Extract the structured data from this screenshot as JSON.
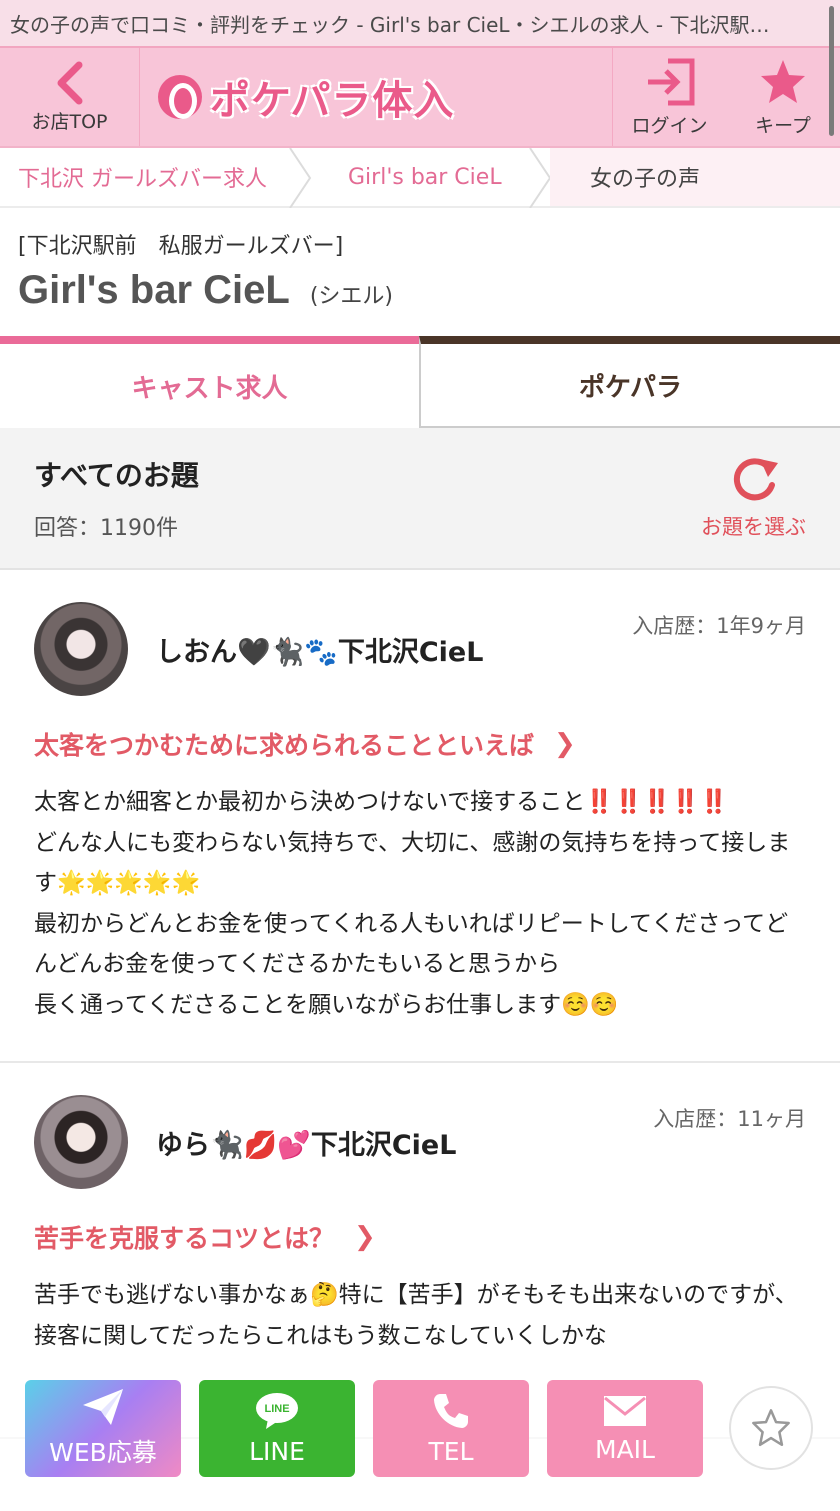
{
  "browser": {
    "title": "女の子の声で口コミ・評判をチェック - Girl's bar CieL・シエルの求人 - 下北沢駅…"
  },
  "header": {
    "back_label": "お店TOP",
    "logo_text": "ポケパラ体入",
    "login_label": "ログイン",
    "keep_label": "キープ"
  },
  "breadcrumb": [
    {
      "label": "下北沢 ガールズバー求人"
    },
    {
      "label": "Girl's bar CieL"
    },
    {
      "label": "女の子の声"
    }
  ],
  "shop": {
    "category": "[下北沢駅前　私服ガールズバー]",
    "name": "Girl's bar CieL",
    "kana": "(シエル)"
  },
  "tabs": [
    {
      "label": "キャスト求人"
    },
    {
      "label": "ポケパラ"
    }
  ],
  "theme": {
    "title": "すべてのお題",
    "count": "回答：1190件",
    "choose_label": "お題を選ぶ"
  },
  "posts": [
    {
      "name": "しおん🖤🐈‍⬛🐾下北沢CieL",
      "tenure": "入店歴：1年9ヶ月",
      "question": "太客をつかむために求められることといえば",
      "answer": "太客とか細客とか最初から決めつけないで接すること‼️‼️‼️‼️‼️\nどんな人にも変わらない気持ちで、大切に、感謝の気持ちを持って接します🌟🌟🌟🌟🌟\n最初からどんとお金を使ってくれる人もいればリピートしてくださってどんどんお金を使ってくださるかたもいると思うから\n長く通ってくださることを願いながらお仕事します☺️☺️"
    },
    {
      "name": "ゆら🐈‍⬛💋💕下北沢CieL",
      "tenure": "入店歴：11ヶ月",
      "question": "苦手を克服するコツとは？",
      "answer": "苦手でも逃げない事かなぁ🤔特に【苦手】がそもそも出来ないのですが、接客に関してだったらこれはもう数こなしていくしかな"
    }
  ],
  "actions": {
    "web_label": "WEB応募",
    "line_label": "LINE",
    "tel_label": "TEL",
    "mail_label": "MAIL",
    "line_badge": "LINE"
  },
  "colors": {
    "brand_pink": "#ea5a8a",
    "question_red": "#e25a66",
    "line_green": "#3bb431",
    "tab_brown": "#4a3528"
  },
  "icons": [
    "chevron-left-icon",
    "logo-mark-icon",
    "login-icon",
    "star-icon",
    "breadcrumb-chevron-icon",
    "refresh-icon",
    "chevron-right-icon",
    "paper-plane-icon",
    "line-icon",
    "phone-icon",
    "mail-icon",
    "favorite-star-icon"
  ]
}
